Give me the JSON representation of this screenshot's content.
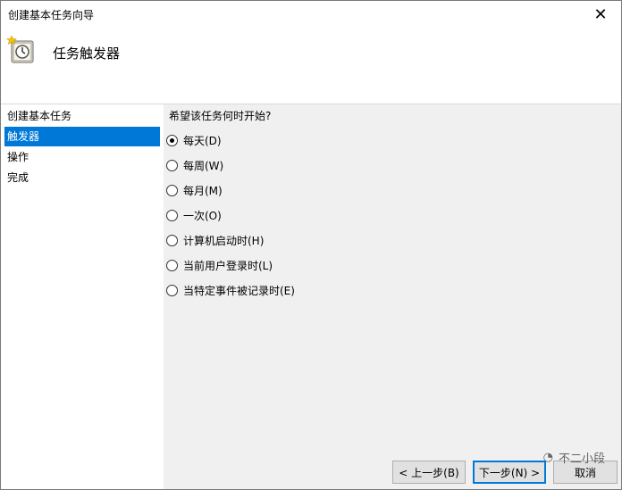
{
  "window": {
    "title": "创建基本任务向导"
  },
  "header": {
    "title": "任务触发器"
  },
  "nav": {
    "items": [
      {
        "label": "创建基本任务"
      },
      {
        "label": "触发器"
      },
      {
        "label": "操作"
      },
      {
        "label": "完成"
      }
    ],
    "selected_index": 1
  },
  "content": {
    "question": "希望该任务何时开始?",
    "options": [
      {
        "label": "每天(D)",
        "checked": true
      },
      {
        "label": "每周(W)",
        "checked": false
      },
      {
        "label": "每月(M)",
        "checked": false
      },
      {
        "label": "一次(O)",
        "checked": false
      },
      {
        "label": "计算机启动时(H)",
        "checked": false
      },
      {
        "label": "当前用户登录时(L)",
        "checked": false
      },
      {
        "label": "当特定事件被记录时(E)",
        "checked": false
      }
    ]
  },
  "buttons": {
    "back": "< 上一步(B)",
    "next": "下一步(N) >",
    "cancel": "取消"
  },
  "watermark": {
    "text": "不二小段"
  },
  "colors": {
    "selection": "#0078d7"
  }
}
